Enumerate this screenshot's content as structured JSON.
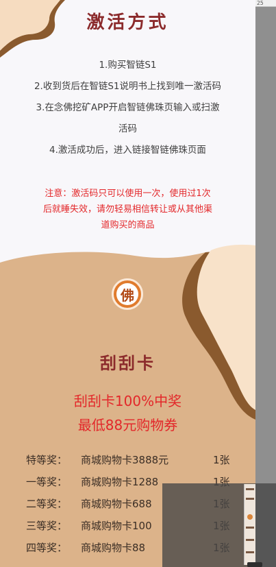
{
  "activation": {
    "title": "激活方式",
    "steps": [
      "1.购买智链S1",
      "2.收到货后在智链S1说明书上找到唯一激活码",
      "3.在念佛挖矿APP开启智链佛珠页输入或扫激",
      "活码",
      "4.激活成功后，进入链接智链佛珠页面"
    ],
    "notice_lines": [
      "注意：激活码只可以使用一次，使用过1次",
      "后就睡失效，请勿轻易相信转让或从其他渠",
      "道购买的商品"
    ]
  },
  "logo": {
    "glyph": "佛",
    "icon": "buddha-logo-icon"
  },
  "scratch_card": {
    "title": "刮刮卡",
    "promo_lines": [
      "刮刮卡100%中奖",
      "最低88元购物券"
    ],
    "prizes": [
      {
        "level": "特等奖：",
        "item": "商城购物卡3888元",
        "qty": "1张"
      },
      {
        "level": "一等奖：",
        "item": "商城购物卡1288",
        "qty": "1张"
      },
      {
        "level": "二等奖：",
        "item": "商城购物卡688",
        "qty": "1张"
      },
      {
        "level": "三等奖：",
        "item": "商城购物卡100",
        "qty": "1张"
      },
      {
        "level": "四等奖：",
        "item": "商城购物卡88",
        "qty": "1张"
      }
    ]
  },
  "ruler": {
    "mark": "25"
  },
  "colors": {
    "title": "#8b2a2b",
    "notice": "#e3272a",
    "tan": "#dcb38a",
    "cream": "#fbe2c8",
    "brown": "#8a5a2e"
  }
}
